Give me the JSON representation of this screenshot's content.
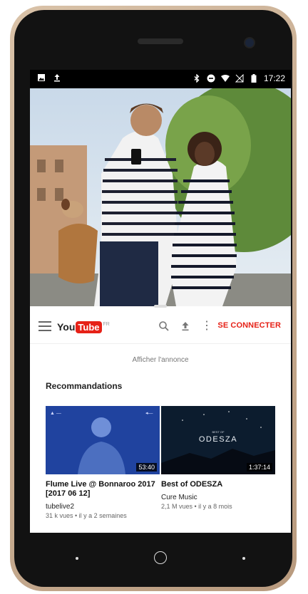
{
  "status_bar": {
    "time": "17:22",
    "left_icons": [
      "image-icon",
      "upload-icon"
    ],
    "right_icons": [
      "bluetooth-icon",
      "do-not-disturb-icon",
      "wifi-icon",
      "no-sim-icon",
      "battery-icon"
    ]
  },
  "youtube": {
    "logo_you": "You",
    "logo_tube": "Tube",
    "logo_region": "FR",
    "signin_label": "SE CONNECTER",
    "ad_label": "Afficher l'annonce",
    "section_title": "Recommandations",
    "videos": [
      {
        "title": "Flume Live @ Bonnaroo 2017 [2017 06 12]",
        "channel": "tubelive2",
        "meta": "31 k vues • il y a 2 semaines",
        "duration": "53:40"
      },
      {
        "title": "Best of ODESZA",
        "channel": "Cure Music",
        "meta": "2,1 M vues • il y a 8 mois",
        "duration": "1:37:14",
        "thumb_text_small": "BEST OF",
        "thumb_text": "ODESZA"
      }
    ]
  },
  "colors": {
    "accent": "#e62117",
    "phone_frame": "#c9ae92",
    "thumb1_bg": "#1b3a8a",
    "thumb2_bg": "#0c1c2e"
  }
}
